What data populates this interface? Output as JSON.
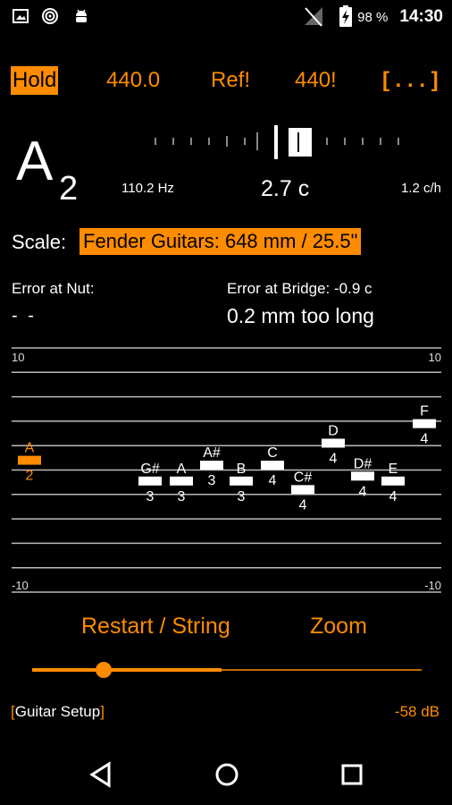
{
  "status_bar": {
    "battery_percent": "98 %",
    "clock": "14:30"
  },
  "toolbar": {
    "hold": "Hold",
    "frequency": "440.0",
    "ref": "Ref!",
    "set440": "440!",
    "menu": "[ . . . ]"
  },
  "note": {
    "name": "A",
    "octave": "2",
    "frequency": "110.2 Hz",
    "cents": "2.7 c",
    "rate": "1.2 c/h"
  },
  "scale": {
    "label": "Scale:",
    "value": "Fender Guitars: 648 mm / 25.5\""
  },
  "errors": {
    "nut_label": "Error at Nut:",
    "nut_value": "- -",
    "bridge_label": "Error at Bridge: -0.9 c",
    "bridge_value": "0.2 mm too long"
  },
  "graph": {
    "y_max": "10",
    "y_min": "-10",
    "current_note": {
      "name": "A",
      "octave": "2",
      "cents": 0.8
    },
    "notes": [
      {
        "name": "G#",
        "octave": "3",
        "cents": -0.9
      },
      {
        "name": "A",
        "octave": "3",
        "cents": -0.9
      },
      {
        "name": "A#",
        "octave": "3",
        "cents": 0.4
      },
      {
        "name": "B",
        "octave": "3",
        "cents": -0.9
      },
      {
        "name": "C",
        "octave": "4",
        "cents": 0.4
      },
      {
        "name": "C#",
        "octave": "4",
        "cents": -1.6
      },
      {
        "name": "D",
        "octave": "4",
        "cents": 2.2
      },
      {
        "name": "D#",
        "octave": "4",
        "cents": -0.5
      },
      {
        "name": "E",
        "octave": "4",
        "cents": -0.9
      },
      {
        "name": "F",
        "octave": "4",
        "cents": 3.8
      }
    ]
  },
  "controls": {
    "restart": "Restart / String",
    "zoom": "Zoom",
    "slider_value": 0.17
  },
  "footer": {
    "setup_label": "Guitar Setup",
    "db": "-58 dB"
  },
  "colors": {
    "accent": "#ff8c00",
    "background": "#000000",
    "text": "#ffffff"
  }
}
